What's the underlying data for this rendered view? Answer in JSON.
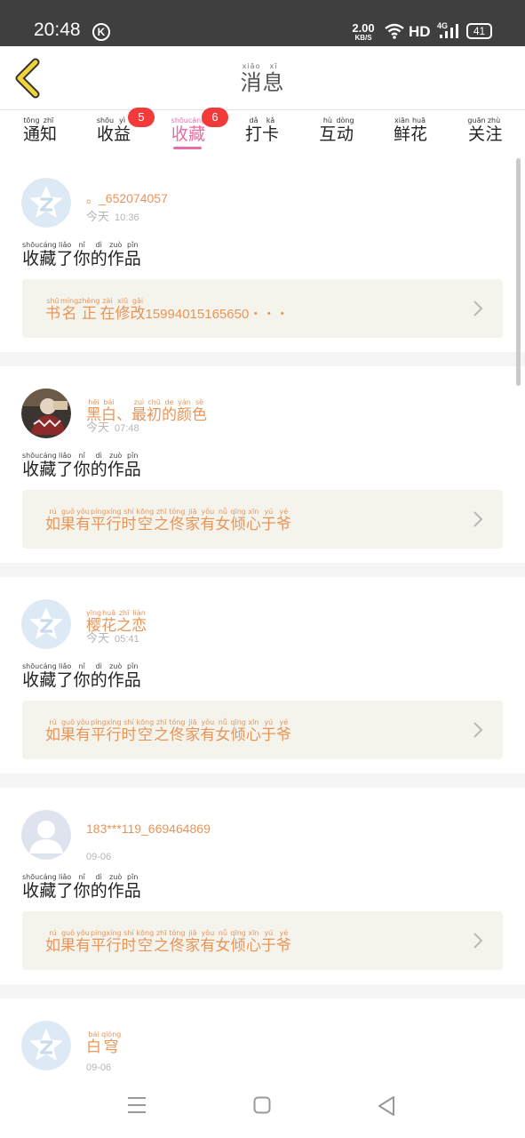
{
  "status_bar": {
    "time": "20:48",
    "k_badge": "K",
    "net_speed": "2.00",
    "net_unit": "KB/S",
    "hd": "HD",
    "network": "4G",
    "battery": "41",
    "icons": [
      "wifi-icon",
      "signal-icon",
      "battery-icon"
    ]
  },
  "header": {
    "back_icon": "chevron-left-icon",
    "title": [
      {
        "c": "消",
        "p": "xiāo"
      },
      {
        "c": "息",
        "p": "xī"
      }
    ]
  },
  "tabs": [
    {
      "chars": [
        {
          "c": "通",
          "p": "tōng"
        },
        {
          "c": "知",
          "p": "zhī"
        }
      ],
      "badge": ""
    },
    {
      "chars": [
        {
          "c": "收",
          "p": "shōu"
        },
        {
          "c": "益",
          "p": "yì"
        }
      ],
      "badge": "5"
    },
    {
      "chars": [
        {
          "c": "收",
          "p": "shōu"
        },
        {
          "c": "藏",
          "p": "cáng"
        }
      ],
      "badge": "6",
      "active": true
    },
    {
      "chars": [
        {
          "c": "打",
          "p": "dǎ"
        },
        {
          "c": "卡",
          "p": "kǎ"
        }
      ],
      "badge": ""
    },
    {
      "chars": [
        {
          "c": "互",
          "p": "hù"
        },
        {
          "c": "动",
          "p": "dòng"
        }
      ],
      "badge": ""
    },
    {
      "chars": [
        {
          "c": "鲜",
          "p": "xiān"
        },
        {
          "c": "花",
          "p": "huā"
        }
      ],
      "badge": ""
    },
    {
      "chars": [
        {
          "c": "关",
          "p": "guān"
        },
        {
          "c": "注",
          "p": "zhù"
        }
      ],
      "badge": ""
    }
  ],
  "messages": [
    {
      "avatar": "default-avatar",
      "username": "。_652074057",
      "day": [
        {
          "c": "今",
          "p": ""
        },
        {
          "c": "天",
          "p": ""
        }
      ],
      "time": "10:36",
      "action": [
        {
          "c": "收",
          "p": "shōu"
        },
        {
          "c": "藏",
          "p": "cáng"
        },
        {
          "c": "了",
          "p": "liǎo"
        },
        {
          "c": "你",
          "p": "nǐ"
        },
        {
          "c": "的",
          "p": "dì"
        },
        {
          "c": "作",
          "p": "zuò"
        },
        {
          "c": "品",
          "p": "pǐn"
        }
      ],
      "work": [
        {
          "c": "书",
          "p": "shū"
        },
        {
          "c": "名",
          "p": "míng"
        },
        {
          "c": "正",
          "p": "zhèng"
        },
        {
          "c": "在",
          "p": "zài"
        },
        {
          "c": "修",
          "p": "xiū"
        },
        {
          "c": "改",
          "p": "gǎi"
        }
      ],
      "work_suffix": "15994015165650・・・",
      "chevron": "chevron-right-icon"
    },
    {
      "avatar": "photo-avatar",
      "username_chars": [
        {
          "c": "黑",
          "p": "hēi"
        },
        {
          "c": "白",
          "p": "bái"
        },
        {
          "c": "、",
          "p": ""
        },
        {
          "c": "最",
          "p": "zuì"
        },
        {
          "c": "初",
          "p": "chū"
        },
        {
          "c": "的",
          "p": "de"
        },
        {
          "c": "颜",
          "p": "yán"
        },
        {
          "c": "色",
          "p": "sè"
        }
      ],
      "day": [
        {
          "c": "今",
          "p": ""
        },
        {
          "c": "天",
          "p": ""
        }
      ],
      "time": "07:48",
      "action": [
        {
          "c": "收",
          "p": "shōu"
        },
        {
          "c": "藏",
          "p": "cáng"
        },
        {
          "c": "了",
          "p": "liǎo"
        },
        {
          "c": "你",
          "p": "nǐ"
        },
        {
          "c": "的",
          "p": "dì"
        },
        {
          "c": "作",
          "p": "zuò"
        },
        {
          "c": "品",
          "p": "pǐn"
        }
      ],
      "work": [
        {
          "c": "如",
          "p": "rú"
        },
        {
          "c": "果",
          "p": "guǒ"
        },
        {
          "c": "有",
          "p": "yǒu"
        },
        {
          "c": "平",
          "p": "píng"
        },
        {
          "c": "行",
          "p": "xíng"
        },
        {
          "c": "时",
          "p": "shí"
        },
        {
          "c": "空",
          "p": "kōng"
        },
        {
          "c": "之",
          "p": "zhī"
        },
        {
          "c": "佟",
          "p": "tóng"
        },
        {
          "c": "家",
          "p": "jiā"
        },
        {
          "c": "有",
          "p": "yǒu"
        },
        {
          "c": "女",
          "p": "nǚ"
        },
        {
          "c": "倾",
          "p": "qīng"
        },
        {
          "c": "心",
          "p": "xīn"
        },
        {
          "c": "于",
          "p": "yú"
        },
        {
          "c": "爷",
          "p": "yé"
        }
      ],
      "chevron": "chevron-right-icon"
    },
    {
      "avatar": "default-avatar",
      "username_chars": [
        {
          "c": "樱",
          "p": "yīng"
        },
        {
          "c": "花",
          "p": "huā"
        },
        {
          "c": "之",
          "p": "zhī"
        },
        {
          "c": "恋",
          "p": "liàn"
        }
      ],
      "day": [
        {
          "c": "今",
          "p": ""
        },
        {
          "c": "天",
          "p": ""
        }
      ],
      "time": "05:41",
      "action": [
        {
          "c": "收",
          "p": "shōu"
        },
        {
          "c": "藏",
          "p": "cáng"
        },
        {
          "c": "了",
          "p": "liǎo"
        },
        {
          "c": "你",
          "p": "nǐ"
        },
        {
          "c": "的",
          "p": "dì"
        },
        {
          "c": "作",
          "p": "zuò"
        },
        {
          "c": "品",
          "p": "pǐn"
        }
      ],
      "work": [
        {
          "c": "如",
          "p": "rú"
        },
        {
          "c": "果",
          "p": "guǒ"
        },
        {
          "c": "有",
          "p": "yǒu"
        },
        {
          "c": "平",
          "p": "píng"
        },
        {
          "c": "行",
          "p": "xíng"
        },
        {
          "c": "时",
          "p": "shí"
        },
        {
          "c": "空",
          "p": "kōng"
        },
        {
          "c": "之",
          "p": "zhī"
        },
        {
          "c": "佟",
          "p": "tóng"
        },
        {
          "c": "家",
          "p": "jiā"
        },
        {
          "c": "有",
          "p": "yǒu"
        },
        {
          "c": "女",
          "p": "nǚ"
        },
        {
          "c": "倾",
          "p": "qīng"
        },
        {
          "c": "心",
          "p": "xīn"
        },
        {
          "c": "于",
          "p": "yú"
        },
        {
          "c": "爷",
          "p": "yé"
        }
      ],
      "chevron": "chevron-right-icon"
    },
    {
      "avatar": "person-avatar",
      "username": "183***119_669464869",
      "date": "09-06",
      "action": [
        {
          "c": "收",
          "p": "shōu"
        },
        {
          "c": "藏",
          "p": "cáng"
        },
        {
          "c": "了",
          "p": "liǎo"
        },
        {
          "c": "你",
          "p": "nǐ"
        },
        {
          "c": "的",
          "p": "dì"
        },
        {
          "c": "作",
          "p": "zuò"
        },
        {
          "c": "品",
          "p": "pǐn"
        }
      ],
      "work": [
        {
          "c": "如",
          "p": "rú"
        },
        {
          "c": "果",
          "p": "guǒ"
        },
        {
          "c": "有",
          "p": "yǒu"
        },
        {
          "c": "平",
          "p": "píng"
        },
        {
          "c": "行",
          "p": "xíng"
        },
        {
          "c": "时",
          "p": "shí"
        },
        {
          "c": "空",
          "p": "kōng"
        },
        {
          "c": "之",
          "p": "zhī"
        },
        {
          "c": "佟",
          "p": "tóng"
        },
        {
          "c": "家",
          "p": "jiā"
        },
        {
          "c": "有",
          "p": "yǒu"
        },
        {
          "c": "女",
          "p": "nǚ"
        },
        {
          "c": "倾",
          "p": "qīng"
        },
        {
          "c": "心",
          "p": "xīn"
        },
        {
          "c": "于",
          "p": "yú"
        },
        {
          "c": "爷",
          "p": "yé"
        }
      ],
      "chevron": "chevron-right-icon"
    },
    {
      "avatar": "default-avatar",
      "username_chars": [
        {
          "c": "白",
          "p": "bái"
        },
        {
          "c": "穹",
          "p": "qióng"
        }
      ],
      "date": "09-06"
    }
  ],
  "nav_bar": [
    "menu-icon",
    "home-icon",
    "back-icon"
  ],
  "colors": {
    "accent": "#e86ca5",
    "badge": "#f23a3a",
    "username": "#e8955a",
    "work_box": "#f4f4ec",
    "status_bar": "#3f3f3f"
  }
}
